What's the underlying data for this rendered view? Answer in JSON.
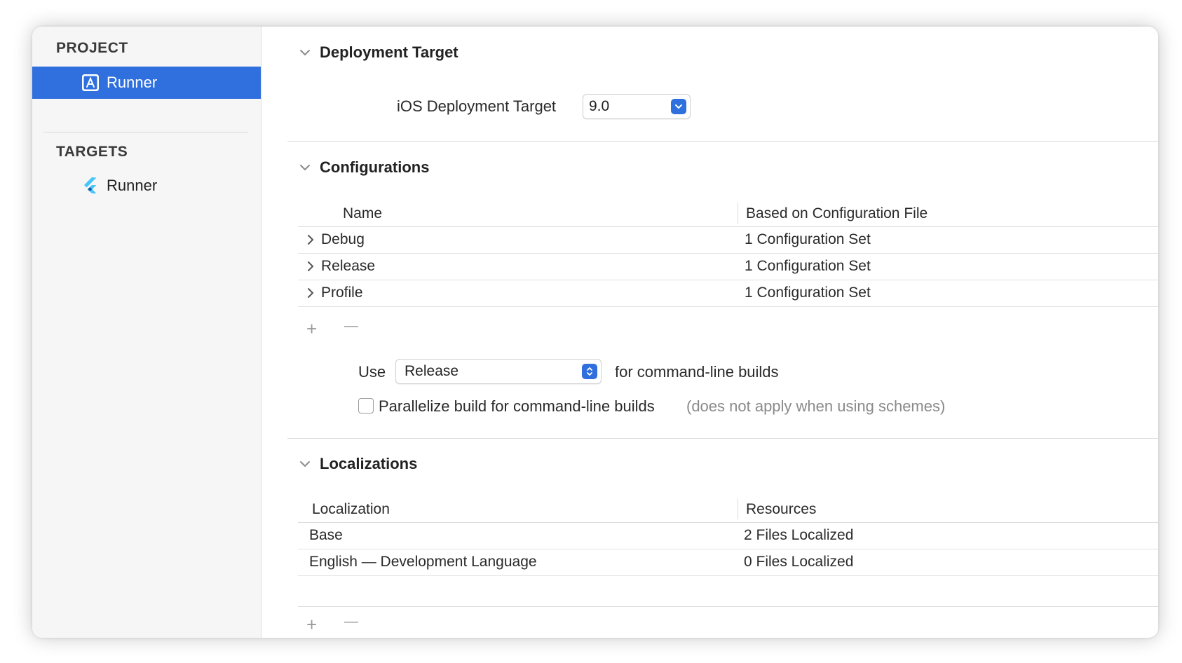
{
  "sidebar": {
    "project_header": "PROJECT",
    "project_item": "Runner",
    "targets_header": "TARGETS",
    "target_item": "Runner"
  },
  "deployment": {
    "title": "Deployment Target",
    "label": "iOS Deployment Target",
    "value": "9.0"
  },
  "configurations": {
    "title": "Configurations",
    "col_name": "Name",
    "col_based": "Based on Configuration File",
    "rows": [
      {
        "name": "Debug",
        "based": "1 Configuration Set"
      },
      {
        "name": "Release",
        "based": "1 Configuration Set"
      },
      {
        "name": "Profile",
        "based": "1 Configuration Set"
      }
    ],
    "add_symbol": "+",
    "remove_symbol": "—",
    "use_label": "Use",
    "use_value": "Release",
    "use_suffix": "for command-line builds",
    "parallelize_label": "Parallelize build for command-line builds",
    "parallelize_note": "(does not apply when using schemes)"
  },
  "localizations": {
    "title": "Localizations",
    "col_localization": "Localization",
    "col_resources": "Resources",
    "rows": [
      {
        "name": "Base",
        "resources": "2 Files Localized"
      },
      {
        "name": "English — Development Language",
        "resources": "0 Files Localized"
      }
    ],
    "add_symbol": "+",
    "remove_symbol": "—"
  },
  "colors": {
    "accent": "#2f6fde",
    "flutter_blue": "#47c5fb",
    "flutter_dark": "#0e5ea8"
  }
}
